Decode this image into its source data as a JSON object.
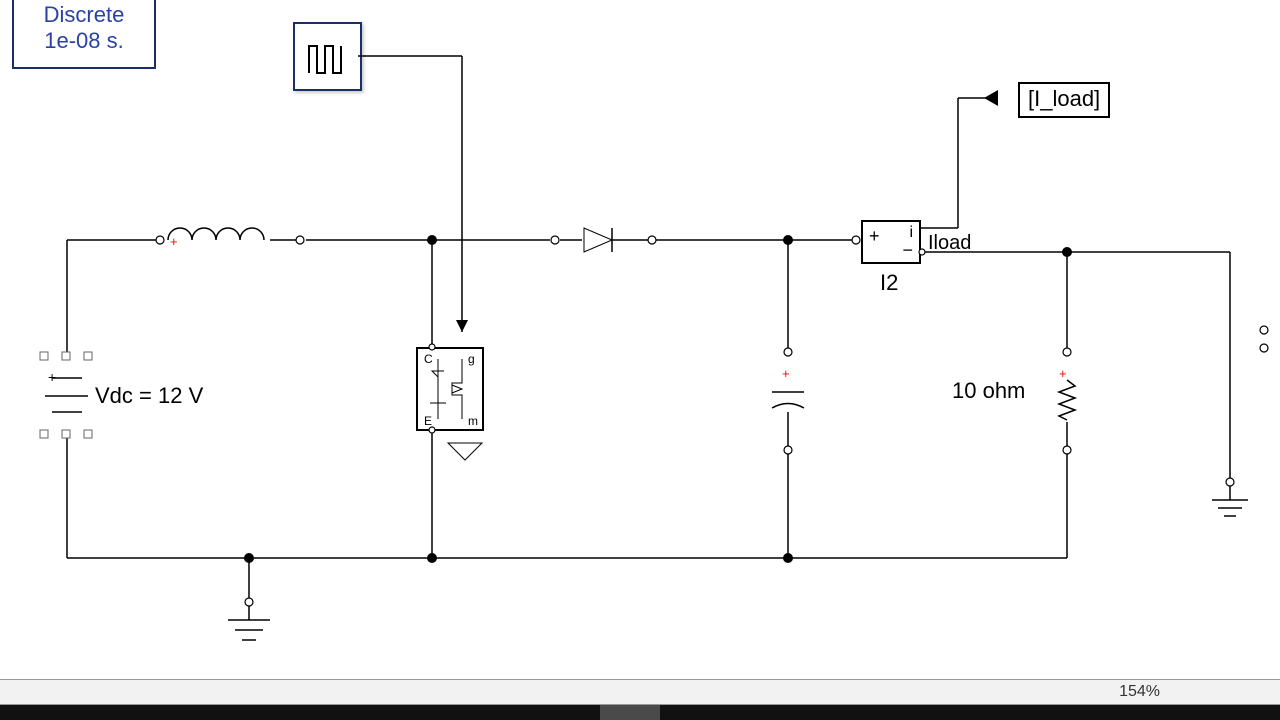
{
  "simulation": {
    "mode_line1": "Discrete",
    "mode_line2": "1e-08 s."
  },
  "pulse": {
    "name": "pulse-generator-icon"
  },
  "goto": {
    "label": "[I_load]"
  },
  "source": {
    "label": "Vdc = 12 V",
    "plus": "+"
  },
  "measurement": {
    "name": "I2",
    "output_label": "Iload",
    "plus": "+",
    "minus": "−",
    "i": "i"
  },
  "resistor": {
    "label": "10 ohm"
  },
  "statusbar": {
    "zoom": "154%"
  },
  "colors": {
    "accent": "#2b41a4",
    "positive": "#f00"
  }
}
